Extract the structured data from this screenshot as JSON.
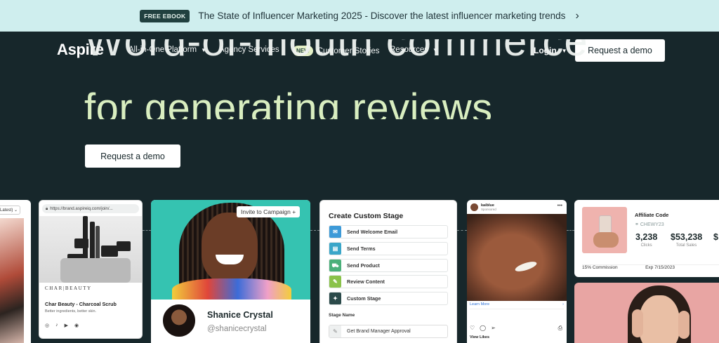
{
  "promo": {
    "badge": "FREE EBOOK",
    "text": "The State of Influencer Marketing 2025 - Discover the latest influencer marketing trends",
    "arrow": "›"
  },
  "nav": {
    "logo": "Aspire",
    "items": [
      {
        "label": "All-in-One Platform",
        "has_caret": true
      },
      {
        "label": "Agency Services",
        "has_caret": false
      },
      {
        "label": "Customer Stories",
        "badge": "NEW",
        "has_caret": false
      },
      {
        "label": "Resources",
        "has_caret": true
      }
    ],
    "login": "Login",
    "cta": "Request a demo"
  },
  "hero": {
    "line1": "Word-of-mouth commerce",
    "line2": "for generating reviews",
    "cta": "Request a demo",
    "accent_color": "#d9eec0",
    "bg_color": "#17272b"
  },
  "cards": {
    "left_partial": {
      "select": "(Latest)  ⌄"
    },
    "storefront": {
      "url": "https://brand.aspireiq.com/join/...",
      "brand": "CHAR|BEAUTY",
      "product_name": "Char Beauty - Charcoal Scrub",
      "product_desc": "Better ingredients, better skin.",
      "social_icons": [
        "instagram-icon",
        "tiktok-icon",
        "youtube-icon",
        "pinterest-icon"
      ]
    },
    "influencer": {
      "invite_label": "Invite to Campaign +",
      "name": "Shanice Crystal",
      "handle": "@shanicecrystal"
    },
    "custom_stage": {
      "title": "Create Custom Stage",
      "stages": [
        {
          "label": "Send Welcome Email",
          "icon": "mail-icon",
          "color": "#3d9ad8"
        },
        {
          "label": "Send Terms",
          "icon": "document-icon",
          "color": "#3aa6c9"
        },
        {
          "label": "Send Product",
          "icon": "truck-icon",
          "color": "#4bb07a"
        },
        {
          "label": "Review Content",
          "icon": "pencil-icon",
          "color": "#8ac24a"
        },
        {
          "label": "Custom Stage",
          "icon": "sparkle-icon",
          "color": "#2b4a4a"
        }
      ],
      "stage_name_label": "Stage Name",
      "stage_name_value": "Get Brand Manager Approval"
    },
    "post": {
      "account": "kaiblue",
      "sponsored": "Sponsored",
      "learn_more": "Learn More",
      "likes": "View Likes"
    },
    "affiliate": {
      "title": "Affiliate Code",
      "code": "CHEWY23",
      "stats": [
        {
          "value": "3,238",
          "label": "Clicks"
        },
        {
          "value": "$53,238",
          "label": "Total Sales"
        },
        {
          "value": "$",
          "label": ""
        }
      ],
      "commission": "15% Commission",
      "expiry": "Exp 7/15/2023"
    }
  }
}
